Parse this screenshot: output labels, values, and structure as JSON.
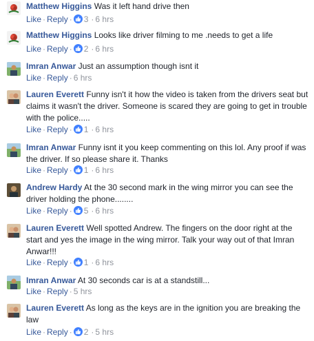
{
  "labels": {
    "like": "Like",
    "reply": "Reply",
    "separator": "·"
  },
  "comments": [
    {
      "author": "Matthew Higgins",
      "text": "Was it left hand drive then",
      "likes": "3",
      "time": "6 hrs",
      "avatar": "rose-icon"
    },
    {
      "author": "Matthew Higgins",
      "text": "Looks like driver filming to me .needs to get a life",
      "likes": "2",
      "time": "6 hrs",
      "avatar": "rose-icon"
    },
    {
      "author": "Imran Anwar",
      "text": "Just an assumption though isnt it",
      "likes": "",
      "time": "6 hrs",
      "avatar": "person-outdoor-icon"
    },
    {
      "author": "Lauren Everett",
      "text": "Funny isn't it how the video is taken from the drivers seat but claims it wasn't the driver. Someone is scared they are going to get in trouble with the police.....",
      "likes": "1",
      "time": "6 hrs",
      "avatar": "couple-photo-icon"
    },
    {
      "author": "Imran Anwar",
      "text": "Funny isnt it you keep commenting on this lol. Any proof if was the driver. If so please share it. Thanks",
      "likes": "1",
      "time": "6 hrs",
      "avatar": "person-outdoor-icon"
    },
    {
      "author": "Andrew Hardy",
      "text": "At the 30 second mark in the wing mirror you can see the driver holding the phone........",
      "likes": "5",
      "time": "6 hrs",
      "avatar": "person-dark-icon"
    },
    {
      "author": "Lauren Everett",
      "text": "Well spotted Andrew. The fingers on the door right at the start and yes the image in the wing mirror. Talk your way out of that Imran Anwar!!!",
      "likes": "1",
      "time": "6 hrs",
      "avatar": "couple-photo-icon"
    },
    {
      "author": "Imran Anwar",
      "text": "At 30 seconds car is at a standstill...",
      "likes": "",
      "time": "5 hrs",
      "avatar": "person-outdoor-icon"
    },
    {
      "author": "Lauren Everett",
      "text": "As long as the keys are in the ignition you are breaking the law",
      "likes": "2",
      "time": "5 hrs",
      "avatar": "couple-photo-icon"
    }
  ],
  "colors": {
    "author": "#365899",
    "text": "#1d2129",
    "muted": "#90949c",
    "like_badge": "#4080ff"
  }
}
